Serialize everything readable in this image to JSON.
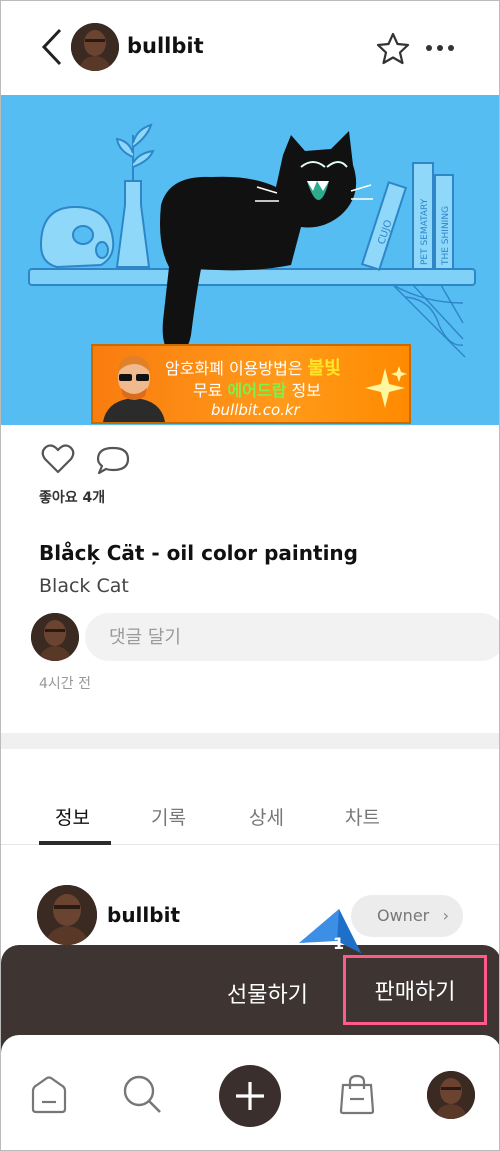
{
  "header": {
    "username": "bullbit",
    "back_icon": "chevron-left-icon",
    "favorite_icon": "star-icon",
    "more_icon": "more-dots-icon"
  },
  "artwork": {
    "book_titles": [
      "CUJO",
      "PET SEMATARY",
      "THE SHINING"
    ],
    "banner": {
      "line1_prefix": "암호화폐 이용방법은",
      "line1_highlight": "불빛",
      "line2_prefix": "무료",
      "line2_highlight": "에어드랍",
      "line2_suffix": "정보",
      "site": "bullbit.co.kr"
    }
  },
  "post": {
    "likes_label": "좋아요 4개",
    "title": "Blåcķ Cät - oil color painting",
    "subtitle": "Black Cat",
    "comment_placeholder": "댓글 달기",
    "time_ago": "4시간 전"
  },
  "tabs": [
    {
      "label": "정보",
      "active": true
    },
    {
      "label": "기록",
      "active": false
    },
    {
      "label": "상세",
      "active": false
    },
    {
      "label": "차트",
      "active": false
    }
  ],
  "owner": {
    "name": "bullbit",
    "badge": "Owner"
  },
  "sheet": {
    "gift_label": "선물하기",
    "sell_label": "판매하기",
    "step_number": "1"
  },
  "colors": {
    "art_background": "#56bdf2",
    "sheet_background": "#3e3432",
    "highlight_border": "#ff5b8a",
    "pointer_blue": "#3d8fe6"
  }
}
